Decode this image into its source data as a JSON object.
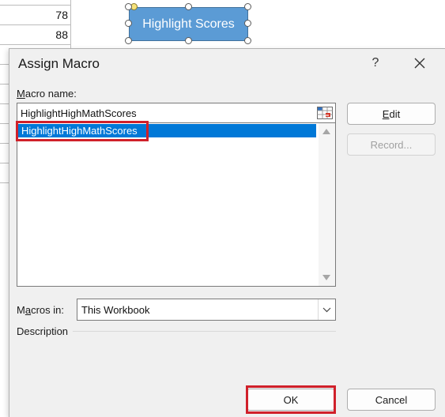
{
  "spreadsheet": {
    "cells": [
      "78",
      "88"
    ]
  },
  "shape": {
    "label": "Highlight Scores",
    "fill_color": "#5b9bd5"
  },
  "dialog": {
    "title": "Assign Macro",
    "help_label": "?",
    "close_icon": "close-icon",
    "macro_name_label_accel": "M",
    "macro_name_label_rest": "acro name:",
    "macro_name_value": "HighlightHighMathScores",
    "macro_list": [
      "HighlightHighMathScores"
    ],
    "selected_color": "#0078d7",
    "edit_label_accel": "E",
    "edit_label_rest": "dit",
    "record_label": "Record...",
    "macros_in_label_pre": "M",
    "macros_in_label_accel": "a",
    "macros_in_label_rest": "cros in:",
    "macros_in_value": "This Workbook",
    "description_label": "Description",
    "ok_label": "OK",
    "cancel_label": "Cancel",
    "highlight_color": "#d0202a"
  }
}
